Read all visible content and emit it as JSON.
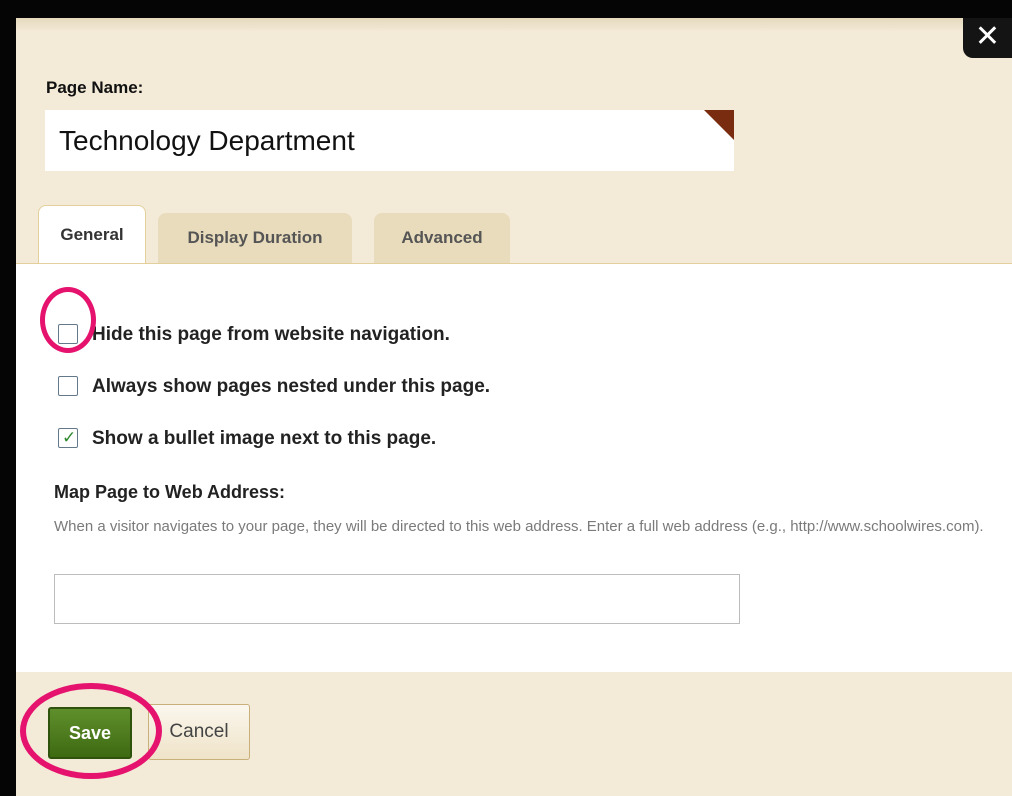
{
  "dialog": {
    "close_symbol": "✕",
    "page_name_label": "Page Name:",
    "page_name_value": "Technology Department"
  },
  "tabs": [
    {
      "label": "General",
      "active": true
    },
    {
      "label": "Display Duration",
      "active": false
    },
    {
      "label": "Advanced",
      "active": false
    }
  ],
  "options": [
    {
      "label": "Hide this page from website navigation.",
      "checked": false
    },
    {
      "label": "Always show pages nested under this page.",
      "checked": false
    },
    {
      "label": "Show a bullet image next to this page.",
      "checked": true
    }
  ],
  "map": {
    "title": "Map Page to Web Address:",
    "description": "When a visitor navigates to your page, they will be directed to this web address. Enter a full web address (e.g., http://www.schoolwires.com).",
    "value": ""
  },
  "buttons": {
    "save": "Save",
    "cancel": "Cancel"
  },
  "checkmark_symbol": "✓",
  "colors": {
    "highlight": "#e5136e",
    "save_green": "#4a7a1e",
    "dialog_bg": "#f3ead8"
  }
}
